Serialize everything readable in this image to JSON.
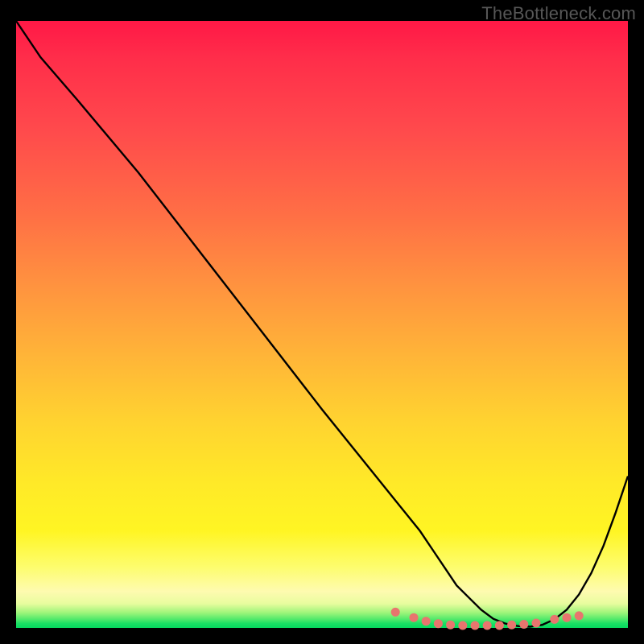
{
  "watermark": "TheBottleneck.com",
  "colors": {
    "background": "#000000",
    "curve_stroke": "#000000",
    "dot_fill": "#e8756e",
    "gradient_top": "#ff1846",
    "gradient_bottom": "#06d95f"
  },
  "chart_data": {
    "type": "line",
    "title": "",
    "xlabel": "",
    "ylabel": "",
    "ylim_percent": [
      0,
      100
    ],
    "xlim_percent": [
      0,
      100
    ],
    "x": [
      0,
      4,
      10,
      20,
      30,
      40,
      50,
      58,
      62,
      66,
      68,
      70,
      72,
      74,
      76,
      78,
      80,
      82,
      84,
      86,
      88,
      90,
      92,
      94,
      96,
      98,
      100
    ],
    "y_pct_from_top": [
      0,
      6,
      13,
      25,
      38,
      51,
      64,
      74,
      79,
      84,
      87,
      90,
      93,
      95,
      97,
      98.5,
      99.3,
      99.7,
      99.8,
      99.5,
      98.6,
      97,
      94.5,
      91,
      86.5,
      81,
      75
    ],
    "dots_x": [
      62,
      65,
      67,
      69,
      71,
      73,
      75,
      77,
      79,
      81,
      83,
      85,
      88,
      90,
      92
    ],
    "dots_y_pct_from_top": [
      97.4,
      98.3,
      98.9,
      99.3,
      99.5,
      99.6,
      99.6,
      99.6,
      99.6,
      99.5,
      99.4,
      99.2,
      98.6,
      98.3,
      98.0
    ]
  }
}
